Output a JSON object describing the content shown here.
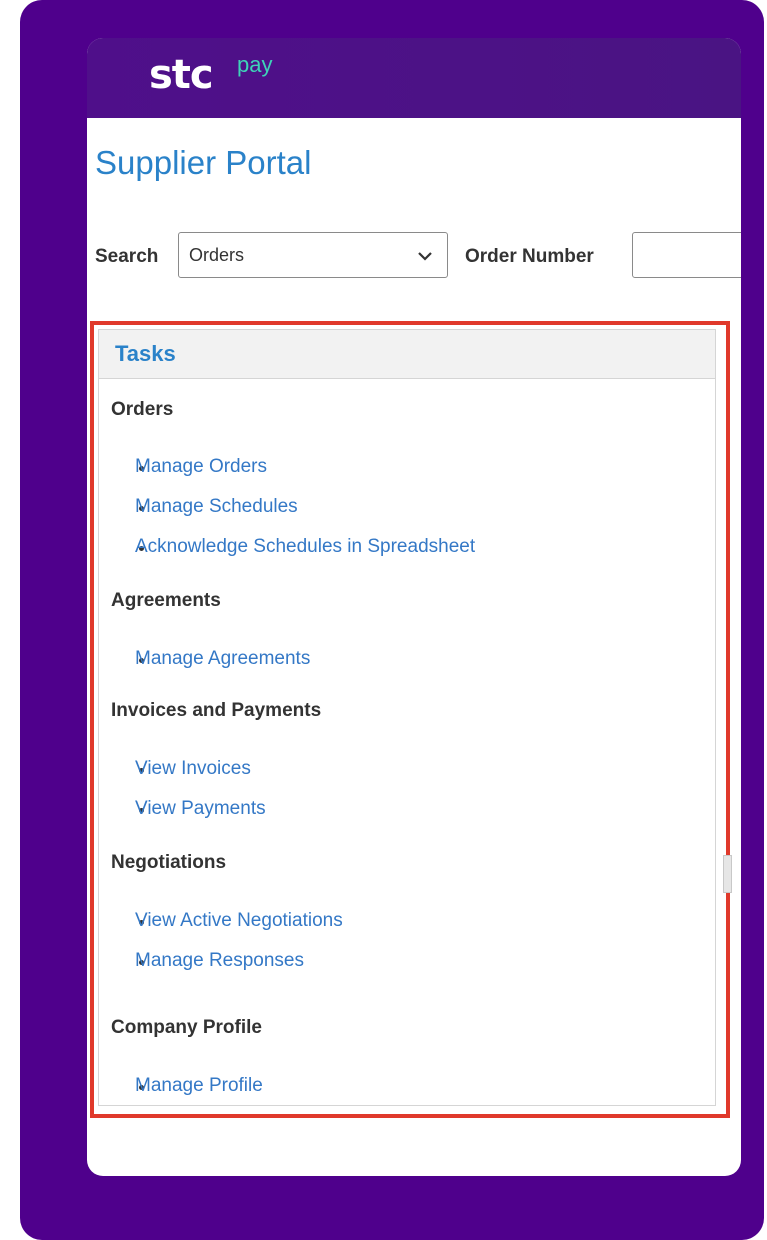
{
  "brand": {
    "logo_main": "stc",
    "logo_sub": "pay"
  },
  "portal": {
    "title": "Supplier Portal"
  },
  "search": {
    "label": "Search",
    "selected": "Orders",
    "order_number_label": "Order Number",
    "order_number_value": ""
  },
  "tasks": {
    "title": "Tasks",
    "sections": [
      {
        "title": "Orders",
        "items": [
          "Manage Orders",
          "Manage Schedules",
          "Acknowledge Schedules in Spreadsheet"
        ]
      },
      {
        "title": "Agreements",
        "items": [
          "Manage Agreements"
        ]
      },
      {
        "title": "Invoices and Payments",
        "items": [
          "View Invoices",
          "View Payments"
        ]
      },
      {
        "title": "Negotiations",
        "items": [
          "View Active Negotiations",
          "Manage Responses"
        ]
      },
      {
        "title": "Company Profile",
        "items": [
          "Manage Profile"
        ]
      }
    ]
  },
  "colors": {
    "frame": "#4f008c",
    "header": "#4b1185",
    "link": "#3478c6",
    "title": "#2a82c9",
    "highlight": "#e0392b"
  }
}
